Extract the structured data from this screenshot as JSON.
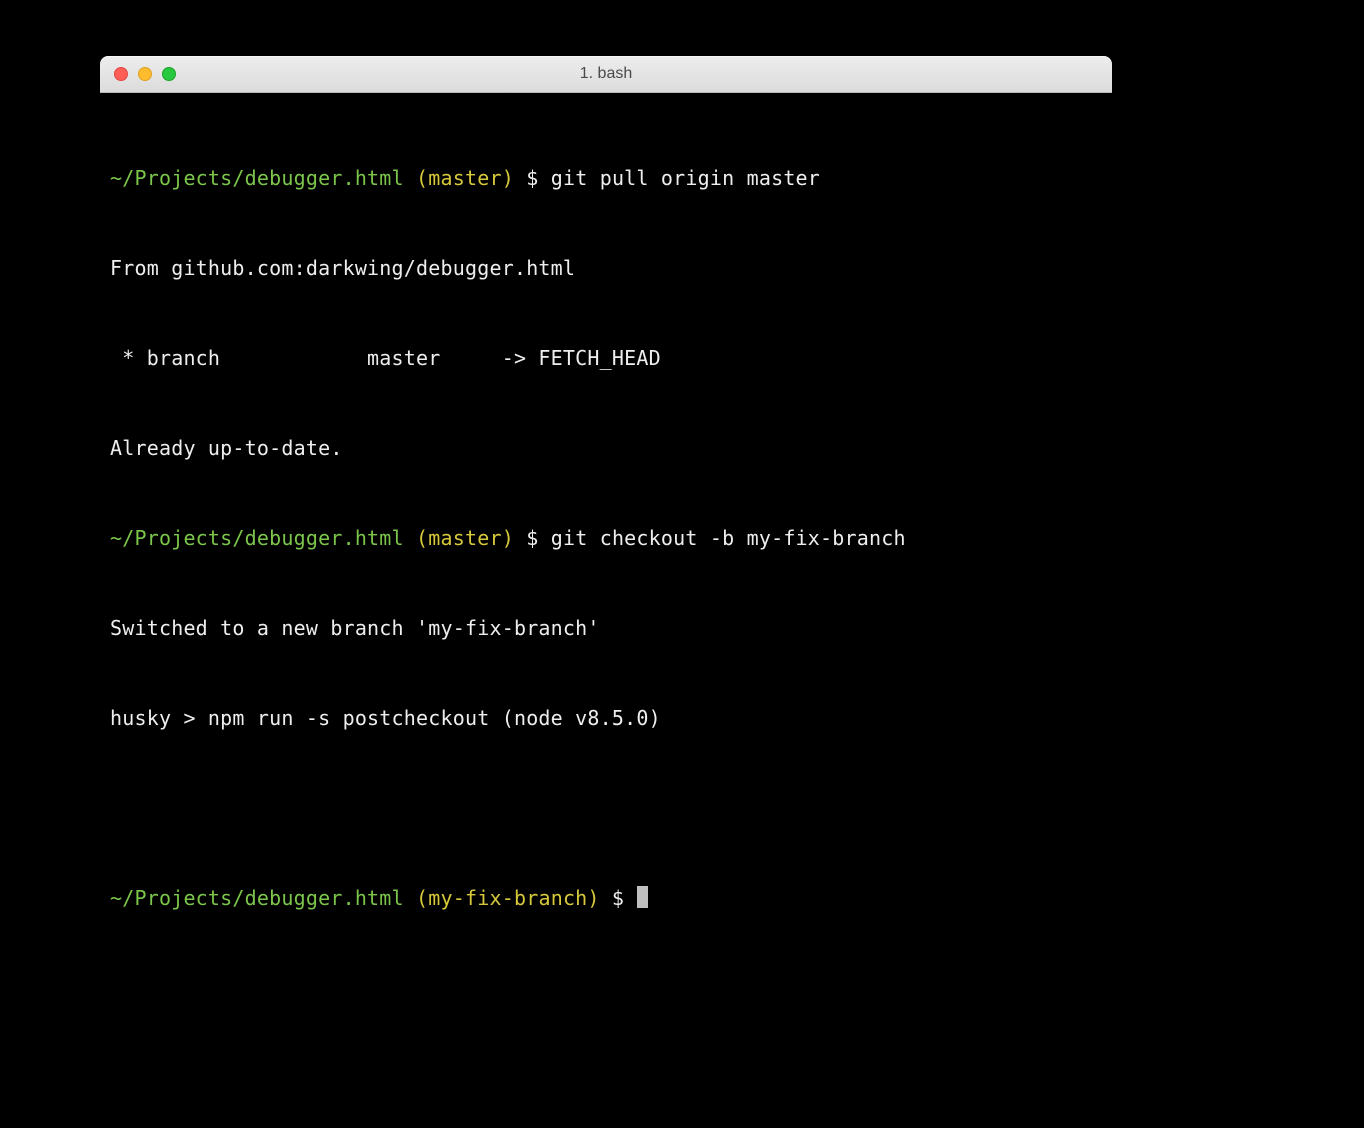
{
  "window": {
    "title": "1. bash"
  },
  "colors": {
    "cwd": "#7bc64a",
    "branch": "#d6c93a",
    "text": "#eeeeee",
    "tl_red": "#ff5f57",
    "tl_yellow": "#febc2e",
    "tl_green": "#28c840"
  },
  "lines": {
    "l1_cwd": "~/Projects/debugger.html",
    "l1_branch": "(master)",
    "l1_cmd": "git pull origin master",
    "l2": "From github.com:darkwing/debugger.html",
    "l3": " * branch            master     -> FETCH_HEAD",
    "l4": "Already up-to-date.",
    "l5_cwd": "~/Projects/debugger.html",
    "l5_branch": "(master)",
    "l5_cmd": "git checkout -b my-fix-branch",
    "l6": "Switched to a new branch 'my-fix-branch'",
    "l7": "husky > npm run -s postcheckout (node v8.5.0)",
    "l9_cwd": "~/Projects/debugger.html",
    "l9_branch": "(my-fix-branch)",
    "dollar": "$"
  }
}
